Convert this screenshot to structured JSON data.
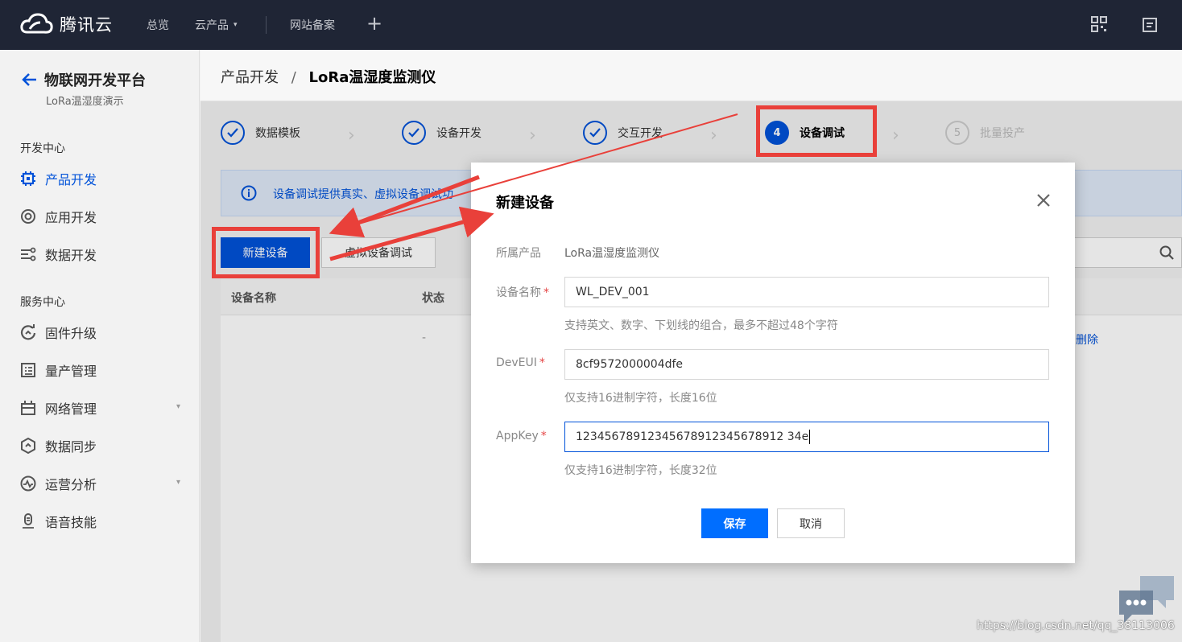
{
  "topbar": {
    "brand": "腾讯云",
    "nav": [
      "总览",
      "云产品",
      "网站备案"
    ],
    "dropdown_arrow": "▾",
    "plus": "+",
    "icons": [
      "qrcode-icon",
      "document-icon"
    ]
  },
  "sidebar": {
    "title": "物联网开发平台",
    "subtitle": "LoRa温湿度演示",
    "dev_section": "开发中心",
    "dev_items": [
      {
        "label": "产品开发",
        "icon": "chip-icon",
        "active": true
      },
      {
        "label": "应用开发",
        "icon": "app-target-icon"
      },
      {
        "label": "数据开发",
        "icon": "data-flow-icon"
      }
    ],
    "service_section": "服务中心",
    "service_items": [
      {
        "label": "固件升级",
        "icon": "firmware-refresh-icon"
      },
      {
        "label": "量产管理",
        "icon": "list-document-icon"
      },
      {
        "label": "网络管理",
        "icon": "network-box-icon",
        "expandable": true
      },
      {
        "label": "数据同步",
        "icon": "sync-icon"
      },
      {
        "label": "运营分析",
        "icon": "analytics-icon",
        "expandable": true
      },
      {
        "label": "语音技能",
        "icon": "voice-icon"
      }
    ]
  },
  "breadcrumb": {
    "parent": "产品开发",
    "separator": "/",
    "current": "LoRa温湿度监测仪"
  },
  "steps": [
    {
      "label": "数据模板",
      "state": "done"
    },
    {
      "label": "设备开发",
      "state": "done"
    },
    {
      "label": "交互开发",
      "state": "done"
    },
    {
      "label": "设备调试",
      "state": "current",
      "num": "4"
    },
    {
      "label": "批量投产",
      "state": "future",
      "num": "5"
    }
  ],
  "info": {
    "text": "设备调试提供真实、虚拟设备调试功"
  },
  "toolbar": {
    "new_device": "新建设备",
    "virtual_debug": "虚拟设备调试"
  },
  "table": {
    "columns": [
      "设备名称",
      "状态"
    ],
    "row": {
      "status": "-",
      "action": "删除"
    }
  },
  "modal": {
    "title": "新建设备",
    "product_label": "所属产品",
    "product_value": "LoRa温湿度监测仪",
    "name_label": "设备名称",
    "name_value": "WL_DEV_001",
    "name_hint": "支持英文、数字、下划线的组合，最多不超过48个字符",
    "deveui_label": "DevEUI",
    "deveui_value": "8cf9572000004dfe",
    "deveui_hint": "仅支持16进制字符，长度16位",
    "appkey_label": "AppKey",
    "appkey_value": "12345678912345678912345678912 34e",
    "appkey_hint": "仅支持16进制字符，长度32位",
    "required_mark": "*",
    "save": "保存",
    "cancel": "取消"
  },
  "watermark": "https://blog.csdn.net/qq_38113006",
  "colors": {
    "primary": "#0052d9",
    "save": "#006eff",
    "annotation": "#e9403a",
    "topbar": "#1f2535"
  }
}
